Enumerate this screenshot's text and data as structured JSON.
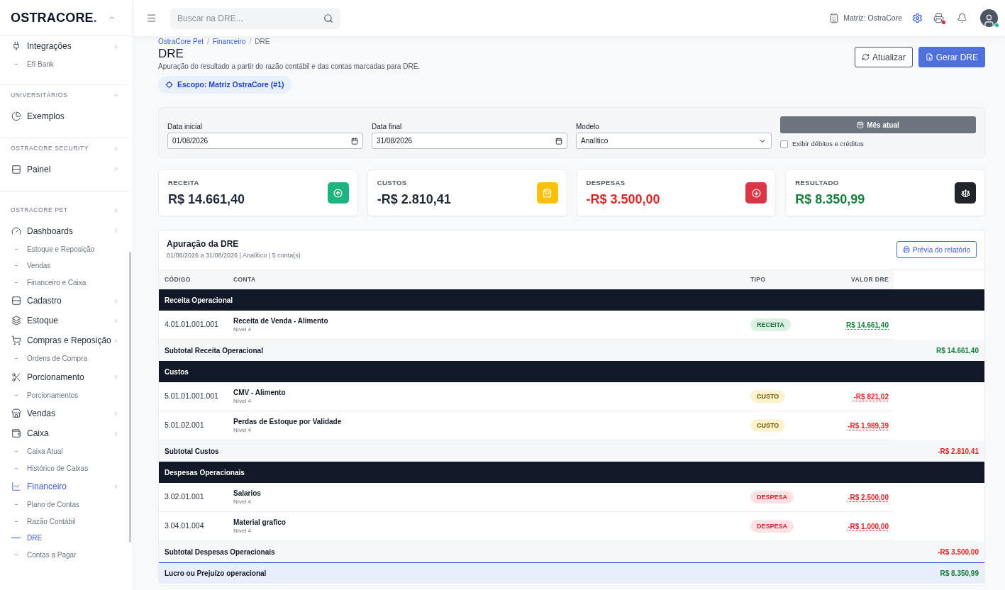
{
  "sidebar": {
    "logo": {
      "text": "OSTRACORE",
      "dot": "."
    },
    "sections": [
      {
        "items": [
          {
            "label": "Integrações",
            "selected": false,
            "chevron": true,
            "children": [
              {
                "label": "Efí Bank",
                "selected": false
              }
            ]
          }
        ]
      },
      {
        "heading": "UNIVERSITÁRIOS",
        "expanded": true,
        "items": [
          {
            "label": "Exemplos",
            "selected": false,
            "chevron": false
          }
        ]
      },
      {
        "heading": "OSTRACORE SECURITY",
        "expanded": false,
        "items": [
          {
            "label": "Painel",
            "selected": false,
            "chevron": true
          }
        ]
      },
      {
        "heading": "OSTRACORE PET",
        "expanded": false,
        "items": [
          {
            "label": "Dashboards",
            "selected": false,
            "chevron": true,
            "children": [
              {
                "label": "Estoque e Reposição",
                "selected": false
              },
              {
                "label": "Vendas",
                "selected": false
              },
              {
                "label": "Financeiro e Caixa",
                "selected": false
              }
            ]
          },
          {
            "label": "Cadastro",
            "selected": false,
            "chevron": true
          },
          {
            "label": "Estoque",
            "selected": false,
            "chevron": true
          },
          {
            "label": "Compras e Reposição",
            "selected": false,
            "chevron": true,
            "children": [
              {
                "label": "Ordens de Compra",
                "selected": false
              }
            ]
          },
          {
            "label": "Porcionamento",
            "selected": false,
            "chevron": true,
            "children": [
              {
                "label": "Porcionamentos",
                "selected": false
              }
            ]
          },
          {
            "label": "Vendas",
            "selected": false,
            "chevron": true
          },
          {
            "label": "Caixa",
            "selected": false,
            "chevron": true,
            "children": [
              {
                "label": "Caixa Atual",
                "selected": false
              },
              {
                "label": "Histórico de Caixas",
                "selected": false
              }
            ]
          },
          {
            "label": "Financeiro",
            "selected": true,
            "chevron": true,
            "children": [
              {
                "label": "Plano de Contas",
                "selected": false
              },
              {
                "label": "Razão Contábil",
                "selected": false
              },
              {
                "label": "DRE",
                "selected": true
              },
              {
                "label": "Contas a Pagar",
                "selected": false
              }
            ]
          }
        ]
      }
    ]
  },
  "header": {
    "search": {
      "placeholder": "Buscar na DRE..."
    },
    "company": "Matriz: OstraCore",
    "printer": {
      "alert": true
    },
    "user": {
      "online": true
    }
  },
  "page": {
    "breadcrumb": {
      "items": [
        "OstraCore Pet",
        "Financeiro",
        "DRE"
      ],
      "separator": "/"
    },
    "title": "DRE",
    "subtitle": "Apuração do resultado a partir do razão contábil e das contas marcadas para DRE.",
    "scope": "Escopo: Matriz OstraCore (#1)",
    "actions": [
      {
        "label": "Atualizar",
        "kind": "outline"
      },
      {
        "label": "Gerar DRE",
        "kind": "primary"
      }
    ]
  },
  "filters": {
    "fields": [
      {
        "label": "Data inicial",
        "value": "01/08/2026",
        "kind": "date"
      },
      {
        "label": "Data final",
        "value": "31/08/2026",
        "kind": "date"
      },
      {
        "label": "Modelo",
        "value": "Analítico",
        "kind": "select"
      }
    ],
    "preset": "Mês atual",
    "toggle": {
      "label": "Exibir débitos e créditos",
      "checked": false
    }
  },
  "cards": [
    {
      "label": "RECEITA",
      "value": {
        "text": "R$ 14.661,40",
        "color": "#1f2937"
      },
      "icon": {
        "color": "#1cb47f"
      }
    },
    {
      "label": "CUSTOS",
      "value": {
        "text": "-R$ 2.810,41",
        "color": "#1f2937"
      },
      "icon": {
        "color": "#ffc107"
      }
    },
    {
      "label": "DESPESAS",
      "value": {
        "text": "-R$ 3.500,00",
        "color": "#dc2626"
      },
      "icon": {
        "color": "#dc3545"
      }
    },
    {
      "label": "RESULTADO",
      "value": {
        "text": "R$ 8.350,99",
        "color": "#15803d"
      },
      "icon": {
        "color": "#212529"
      }
    }
  ],
  "report": {
    "title": "Apuração da DRE",
    "subtitle": "01/08/2026 a 31/08/2026 | Analítico | 5 conta(s)",
    "preview": "Prévia do relatório",
    "columns": [
      "CÓDIGO",
      "CONTA",
      "TIPO",
      "VALOR DRE"
    ],
    "rows": [
      {
        "kind": "group",
        "label": "Receita Operacional"
      },
      {
        "kind": "account",
        "code": "4.01.01.001.001",
        "name": "Receita de Venda - Alimento",
        "note": "Nível 4",
        "type": {
          "label": "RECEITA",
          "kind": "revenue"
        },
        "value": {
          "text": "R$ 14.661,40",
          "color": "#15803d"
        }
      },
      {
        "kind": "subtotal",
        "label": "Subtotal Receita Operacional",
        "value": {
          "text": "R$ 14.661,40",
          "color": "#15803d"
        }
      },
      {
        "kind": "group",
        "label": "Custos"
      },
      {
        "kind": "account",
        "code": "5.01.01.001.001",
        "name": "CMV - Alimento",
        "note": "Nível 4",
        "type": {
          "label": "CUSTO",
          "kind": "cost"
        },
        "value": {
          "text": "-R$ 821,02",
          "color": "#dc2626"
        }
      },
      {
        "kind": "account",
        "code": "5.01.02.001",
        "name": "Perdas de Estoque por Validade",
        "note": "Nível 4",
        "type": {
          "label": "CUSTO",
          "kind": "cost"
        },
        "value": {
          "text": "-R$ 1.989,39",
          "color": "#dc2626"
        }
      },
      {
        "kind": "subtotal",
        "label": "Subtotal Custos",
        "value": {
          "text": "-R$ 2.810,41",
          "color": "#dc2626"
        }
      },
      {
        "kind": "group",
        "label": "Despesas Operacionais"
      },
      {
        "kind": "account",
        "code": "3.02.01.001",
        "name": "Salarios",
        "note": "Nível 4",
        "type": {
          "label": "DESPESA",
          "kind": "expense"
        },
        "value": {
          "text": "-R$ 2.500,00",
          "color": "#dc2626"
        }
      },
      {
        "kind": "account",
        "code": "3.04.01.004",
        "name": "Material grafico",
        "note": "Nível 4",
        "type": {
          "label": "DESPESA",
          "kind": "expense"
        },
        "value": {
          "text": "-R$ 1.000,00",
          "color": "#dc2626"
        }
      },
      {
        "kind": "subtotal",
        "label": "Subtotal Despesas Operacionais",
        "value": {
          "text": "-R$ 3.500,00",
          "color": "#dc2626"
        }
      },
      {
        "kind": "total",
        "label": "Lucro ou Prejuízo operacional",
        "value": {
          "text": "R$ 8.350,99",
          "color": "#15803d"
        }
      }
    ]
  }
}
